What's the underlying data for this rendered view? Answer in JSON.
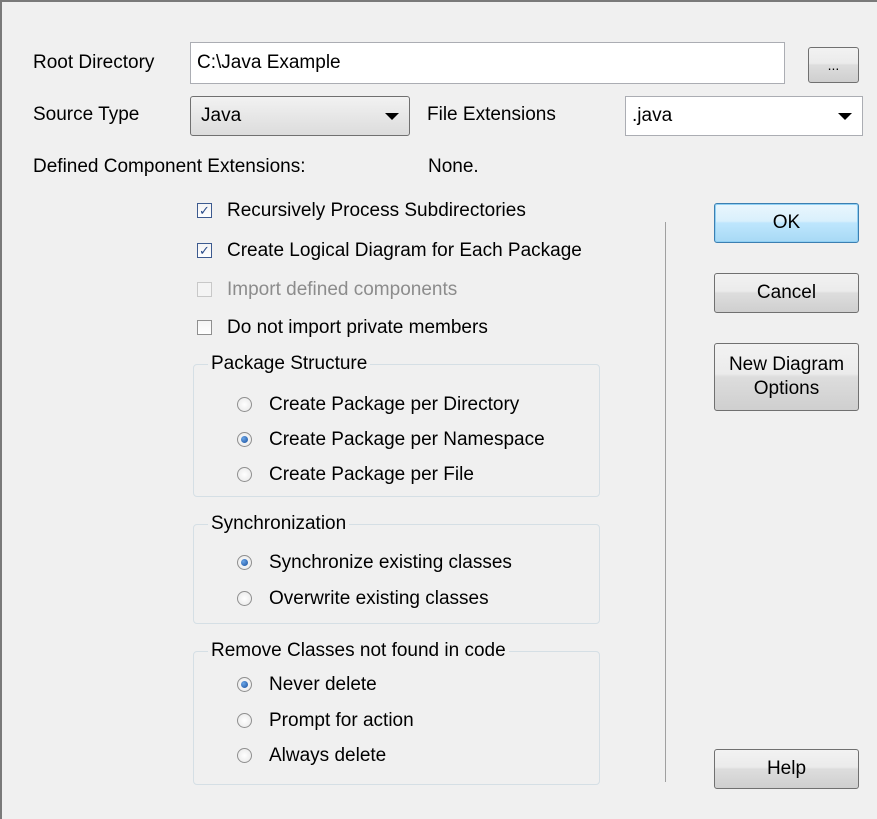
{
  "root_directory": {
    "label": "Root Directory",
    "value": "C:\\Java Example",
    "browse_label": "..."
  },
  "source_type": {
    "label": "Source Type",
    "value": "Java"
  },
  "file_extensions": {
    "label": "File Extensions",
    "value": ".java"
  },
  "component_extensions": {
    "label": "Defined Component Extensions:",
    "value": "None."
  },
  "options": {
    "recursive": {
      "label": "Recursively Process Subdirectories",
      "checked": true
    },
    "logical_diagram": {
      "label": "Create Logical Diagram for Each Package",
      "checked": true
    },
    "import_components": {
      "label": "Import defined components",
      "checked": false,
      "disabled": true
    },
    "no_private": {
      "label": "Do not import private members",
      "checked": false
    }
  },
  "package_structure": {
    "title": "Package Structure",
    "options": [
      "Create Package per Directory",
      "Create Package per Namespace",
      "Create Package per File"
    ],
    "selected_index": 1
  },
  "synchronization": {
    "title": "Synchronization",
    "options": [
      "Synchronize existing classes",
      "Overwrite existing classes"
    ],
    "selected_index": 0
  },
  "remove_classes": {
    "title": "Remove Classes not found in code",
    "options": [
      "Never delete",
      "Prompt for action",
      "Always delete"
    ],
    "selected_index": 0
  },
  "buttons": {
    "ok": "OK",
    "cancel": "Cancel",
    "new_diagram_line1": "New Diagram",
    "new_diagram_line2": "Options",
    "help": "Help"
  }
}
